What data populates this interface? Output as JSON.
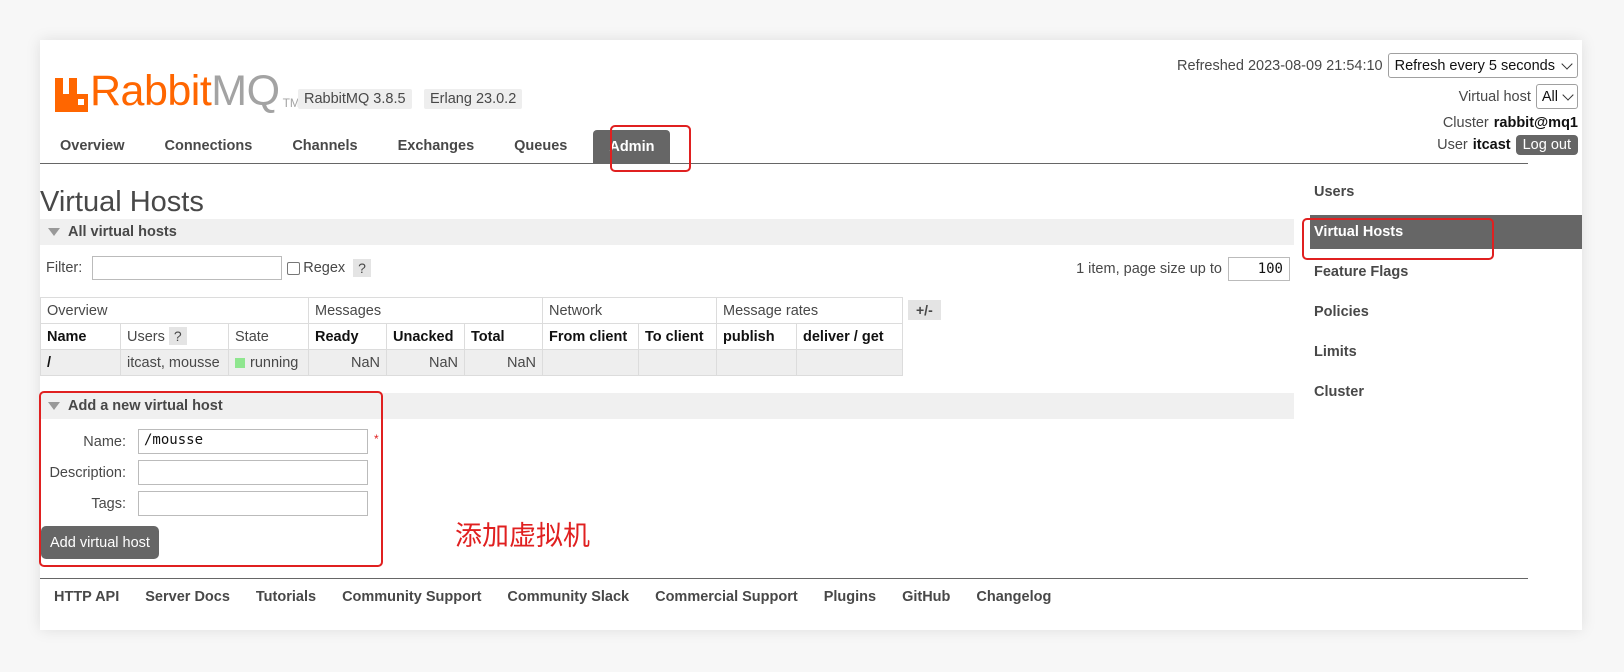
{
  "header": {
    "logo_text_rabbit": "Rabbit",
    "logo_text_mq": "MQ",
    "logo_tm": "TM",
    "version": "RabbitMQ 3.8.5",
    "erlang": "Erlang 23.0.2",
    "refreshed": "Refreshed 2023-08-09 21:54:10",
    "refresh_select": "Refresh every 5 seconds",
    "vhost_label": "Virtual host",
    "vhost_select": "All",
    "cluster_label": "Cluster",
    "cluster_value": "rabbit@mq1",
    "user_label": "User",
    "user_value": "itcast",
    "logout": "Log out"
  },
  "nav": {
    "tabs": [
      "Overview",
      "Connections",
      "Channels",
      "Exchanges",
      "Queues",
      "Admin"
    ]
  },
  "main": {
    "title": "Virtual Hosts",
    "section_all": "All virtual hosts",
    "filter_label": "Filter:",
    "regex_label": "Regex",
    "help": "?",
    "page_info": "1 item, page size up to",
    "page_size": "100",
    "table": {
      "groups": [
        "Overview",
        "Messages",
        "Network",
        "Message rates"
      ],
      "plusminus": "+/-",
      "headers": [
        "Name",
        "Users",
        "State",
        "Ready",
        "Unacked",
        "Total",
        "From client",
        "To client",
        "publish",
        "deliver / get"
      ],
      "row": {
        "name": "/",
        "users": "itcast, mousse",
        "state": "running",
        "ready": "NaN",
        "unacked": "NaN",
        "total": "NaN"
      }
    },
    "section_add": "Add a new virtual host",
    "form": {
      "name_label": "Name:",
      "name_value": "/mousse",
      "description_label": "Description:",
      "tags_label": "Tags:",
      "required_mark": "*",
      "submit": "Add virtual host"
    },
    "annotation": "添加虚拟机"
  },
  "sidebar": {
    "items": [
      "Users",
      "Virtual Hosts",
      "Feature Flags",
      "Policies",
      "Limits",
      "Cluster"
    ]
  },
  "footer": {
    "links": [
      "HTTP API",
      "Server Docs",
      "Tutorials",
      "Community Support",
      "Community Slack",
      "Commercial Support",
      "Plugins",
      "GitHub",
      "Changelog"
    ]
  },
  "colors": {
    "brand_orange": "#ff6600",
    "tab_active": "#666666",
    "annotation_red": "#e02020"
  }
}
